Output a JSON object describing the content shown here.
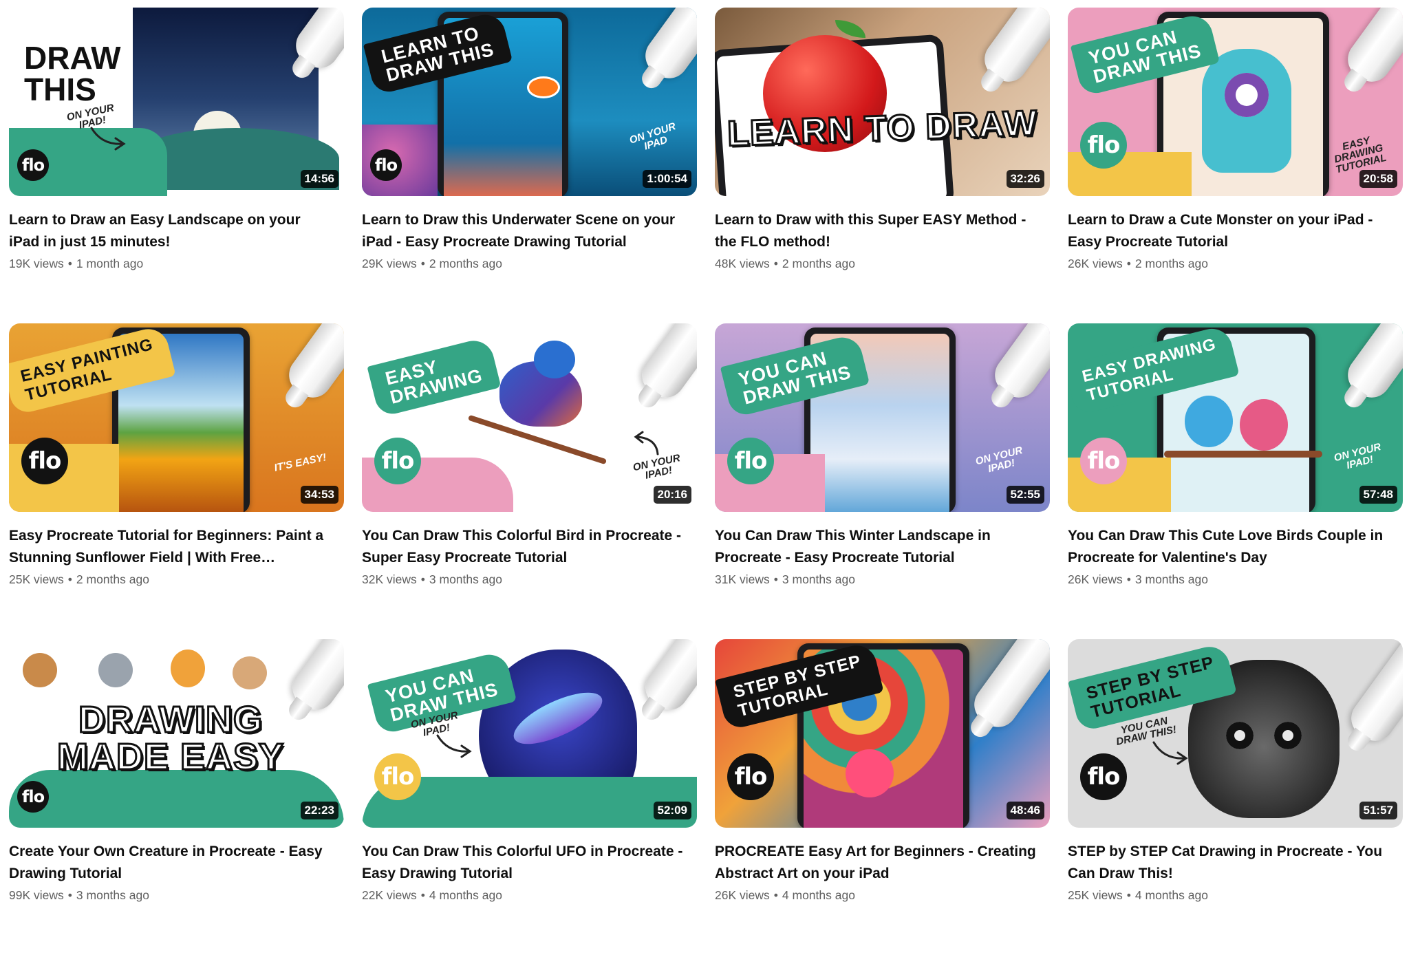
{
  "colors": {
    "green": "#35a585",
    "pink": "#ec9ebd",
    "yellow": "#f3c548",
    "black": "#121212"
  },
  "videos": [
    {
      "title": "Learn to Draw an Easy Landscape on your iPad in just 15 minutes!",
      "views": "19K views",
      "age": "1 month ago",
      "duration": "14:56",
      "thumb": {
        "big_text": "DRAW\nTHIS",
        "note": "ON YOUR\niPAD!",
        "logo": "flo",
        "logo_icon": "flo-logo-icon"
      }
    },
    {
      "title": "Learn to Draw this Underwater Scene on your iPad - Easy Procreate Drawing Tutorial",
      "views": "29K views",
      "age": "2 months ago",
      "duration": "1:00:54",
      "thumb": {
        "banner": "LEARN TO\nDRAW THIS",
        "note": "ON YOUR\niPAD",
        "logo": "flo",
        "logo_icon": "flo-logo-icon"
      }
    },
    {
      "title": "Learn to Draw with this Super EASY Method - the FLO method!",
      "views": "48K views",
      "age": "2 months ago",
      "duration": "32:26",
      "thumb": {
        "big_text": "LEARN TO DRAW"
      }
    },
    {
      "title": "Learn to Draw a Cute Monster on your iPad - Easy Procreate Tutorial",
      "views": "26K views",
      "age": "2 months ago",
      "duration": "20:58",
      "thumb": {
        "banner": "YOU CAN\nDRAW THIS",
        "note": "EASY\nDRAWING\nTUTORIAL",
        "logo": "flo",
        "logo_icon": "flo-logo-icon"
      }
    },
    {
      "title": "Easy Procreate Tutorial for Beginners: Paint a Stunning Sunflower Field | With Free…",
      "views": "25K views",
      "age": "2 months ago",
      "duration": "34:53",
      "thumb": {
        "banner": "EASY PAINTING\nTUTORIAL",
        "note": "iT'S EASY!",
        "logo": "flo",
        "logo_icon": "flo-logo-icon"
      }
    },
    {
      "title": "You Can Draw This Colorful Bird in Procreate - Super Easy Procreate Tutorial",
      "views": "32K views",
      "age": "3 months ago",
      "duration": "20:16",
      "thumb": {
        "banner": "EASY\nDRAWiNG",
        "note": "ON YOUR\niPAD!",
        "logo": "flo",
        "logo_icon": "flo-logo-icon"
      }
    },
    {
      "title": "You Can Draw This Winter Landscape in Procreate - Easy Procreate Tutorial",
      "views": "31K views",
      "age": "3 months ago",
      "duration": "52:55",
      "thumb": {
        "banner": "YOU CAN\nDRAW THIS",
        "note": "ON YOUR\niPAD!",
        "logo": "flo",
        "logo_icon": "flo-logo-icon"
      }
    },
    {
      "title": "You Can Draw This Cute Love Birds Couple in Procreate for Valentine's Day",
      "views": "26K views",
      "age": "3 months ago",
      "duration": "57:48",
      "thumb": {
        "banner": "EASY DRAWiNG\nTUTORIAL",
        "note": "ON YOUR\niPAD!",
        "logo": "flo",
        "logo_icon": "flo-logo-icon"
      }
    },
    {
      "title": "Create Your Own Creature in Procreate - Easy Drawing Tutorial",
      "views": "99K views",
      "age": "3 months ago",
      "duration": "22:23",
      "thumb": {
        "big_text": "DRAWiNG\nMADE EASY",
        "logo": "flo",
        "logo_icon": "flo-logo-icon"
      }
    },
    {
      "title": "You Can Draw This Colorful UFO in Procreate - Easy Drawing Tutorial",
      "views": "22K views",
      "age": "4 months ago",
      "duration": "52:09",
      "thumb": {
        "banner": "YOU CAN\nDRAW THIS",
        "note": "ON YOUR\niPAD!",
        "logo": "flo",
        "logo_icon": "flo-logo-icon"
      }
    },
    {
      "title": "PROCREATE Easy Art for Beginners - Creating Abstract Art on your iPad",
      "views": "26K views",
      "age": "4 months ago",
      "duration": "48:46",
      "thumb": {
        "banner": "STEP BY STEP\nTUTORiAL",
        "logo": "flo",
        "logo_icon": "flo-logo-icon"
      }
    },
    {
      "title": "STEP by STEP Cat Drawing in Procreate - You Can Draw This!",
      "views": "25K views",
      "age": "4 months ago",
      "duration": "51:57",
      "thumb": {
        "banner": "STEP BY STEP\nTUTORiAL",
        "note": "YOU CAN\nDRAW THiS!",
        "logo": "flo",
        "logo_icon": "flo-logo-icon"
      }
    }
  ]
}
